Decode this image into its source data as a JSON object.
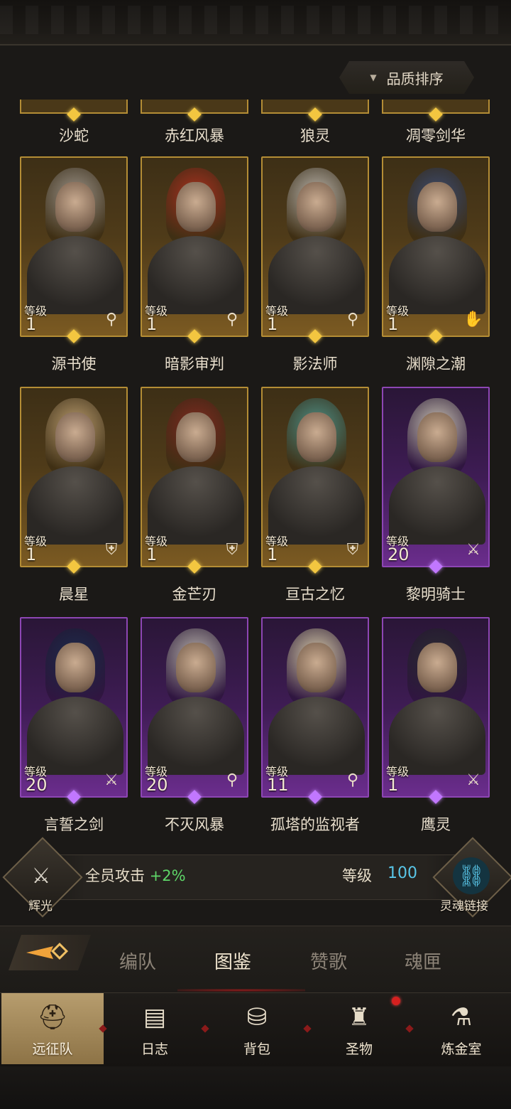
{
  "sort": {
    "label": "品质排序",
    "arrow": "▼"
  },
  "partial_row": {
    "names": [
      "沙蛇",
      "赤红风暴",
      "狼灵",
      "凋零剑华"
    ]
  },
  "heroes": [
    {
      "name": "源书使",
      "level_label": "等级",
      "level": "1",
      "rarity": "gold",
      "class_icon": "staff-icon",
      "glyph": "⚲",
      "hair": "#9a9186"
    },
    {
      "name": "暗影审判",
      "level_label": "等级",
      "level": "1",
      "rarity": "gold",
      "class_icon": "staff-icon",
      "glyph": "⚲",
      "hair": "#a8321f"
    },
    {
      "name": "影法师",
      "level_label": "等级",
      "level": "1",
      "rarity": "gold",
      "class_icon": "staff-icon",
      "glyph": "⚲",
      "hair": "#b9b3aa"
    },
    {
      "name": "渊隙之潮",
      "level_label": "等级",
      "level": "1",
      "rarity": "gold",
      "class_icon": "hand-icon",
      "glyph": "✋",
      "hair": "#3c4a6d"
    },
    {
      "name": "晨星",
      "level_label": "等级",
      "level": "1",
      "rarity": "gold",
      "class_icon": "shield-icon",
      "glyph": "⛨",
      "hair": "#b89a6c"
    },
    {
      "name": "金芒刃",
      "level_label": "等级",
      "level": "1",
      "rarity": "gold",
      "class_icon": "shield-icon",
      "glyph": "⛨",
      "hair": "#7e2a20"
    },
    {
      "name": "亘古之忆",
      "level_label": "等级",
      "level": "1",
      "rarity": "gold",
      "class_icon": "shield-icon",
      "glyph": "⛨",
      "hair": "#4f8e84"
    },
    {
      "name": "黎明骑士",
      "level_label": "等级",
      "level": "20",
      "rarity": "purple",
      "class_icon": "sword-icon",
      "glyph": "⚔",
      "hair": "#c9c2b4"
    },
    {
      "name": "言誓之剑",
      "level_label": "等级",
      "level": "20",
      "rarity": "purple",
      "class_icon": "sword-icon",
      "glyph": "⚔",
      "hair": "#1d2b4a"
    },
    {
      "name": "不灭风暴",
      "level_label": "等级",
      "level": "20",
      "rarity": "purple",
      "class_icon": "staff-icon",
      "glyph": "⚲",
      "hair": "#b6b0aa"
    },
    {
      "name": "孤塔的监视者",
      "level_label": "等级",
      "level": "11",
      "rarity": "purple",
      "class_icon": "staff-icon",
      "glyph": "⚲",
      "hair": "#d7cba9"
    },
    {
      "name": "鹰灵",
      "level_label": "等级",
      "level": "1",
      "rarity": "purple",
      "class_icon": "sword-icon",
      "glyph": "⚔",
      "hair": "#2b2b33"
    }
  ],
  "buff": {
    "left_caption": "辉光",
    "text": "全员攻击",
    "value": "+2%",
    "level_label": "等级",
    "level_value": "100",
    "right_caption": "灵魂链接",
    "value_color": "#5ed668",
    "level_color": "#59c6e8"
  },
  "sub_tabs": {
    "back_icon": "back-arrow-icon",
    "items": [
      {
        "label": "编队",
        "active": false
      },
      {
        "label": "图鉴",
        "active": true
      },
      {
        "label": "赞歌",
        "active": false
      },
      {
        "label": "魂匣",
        "active": false
      }
    ]
  },
  "bottom_nav": [
    {
      "label": "远征队",
      "icon": "horned-helmet-icon",
      "glyph": "⛑",
      "active": true
    },
    {
      "label": "日志",
      "icon": "scroll-icon",
      "glyph": "📜",
      "active": false
    },
    {
      "label": "背包",
      "icon": "backpack-icon",
      "glyph": "🎒",
      "active": false
    },
    {
      "label": "圣物",
      "icon": "chalice-icon",
      "glyph": "🏆",
      "active": false,
      "notification": true
    },
    {
      "label": "炼金室",
      "icon": "alchemy-icon",
      "glyph": "⚗",
      "active": false
    }
  ]
}
